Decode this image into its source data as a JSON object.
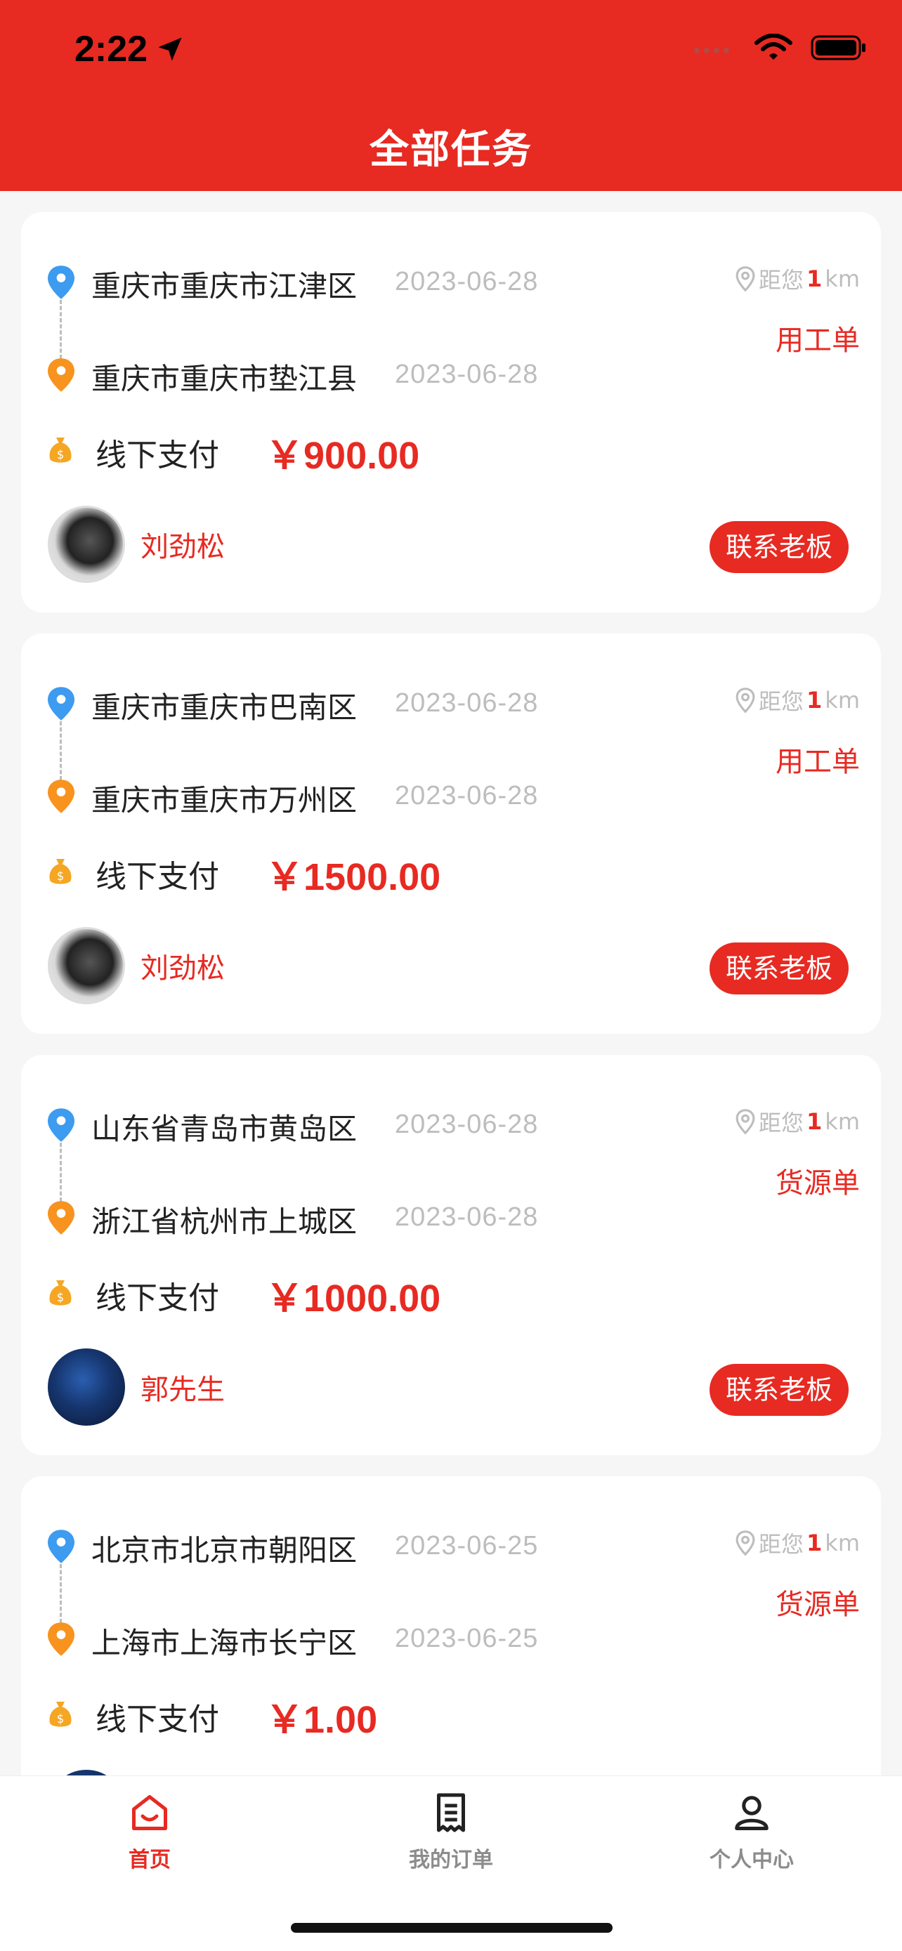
{
  "status_bar": {
    "time": "2:22"
  },
  "header": {
    "title": "全部任务"
  },
  "labels": {
    "distance_prefix": "距您",
    "distance_unit": "km",
    "contact": "联系老板",
    "currency": "￥"
  },
  "tasks": [
    {
      "from": "重庆市重庆市江津区",
      "from_date": "2023-06-28",
      "to": "重庆市重庆市垫江县",
      "to_date": "2023-06-28",
      "distance": "1",
      "type": "用工单",
      "payment": "线下支付",
      "price": "￥900.00",
      "user": "刘劲松"
    },
    {
      "from": "重庆市重庆市巴南区",
      "from_date": "2023-06-28",
      "to": "重庆市重庆市万州区",
      "to_date": "2023-06-28",
      "distance": "1",
      "type": "用工单",
      "payment": "线下支付",
      "price": "￥1500.00",
      "user": "刘劲松"
    },
    {
      "from": "山东省青岛市黄岛区",
      "from_date": "2023-06-28",
      "to": "浙江省杭州市上城区",
      "to_date": "2023-06-28",
      "distance": "1",
      "type": "货源单",
      "payment": "线下支付",
      "price": "￥1000.00",
      "user": "郭先生"
    },
    {
      "from": "北京市北京市朝阳区",
      "from_date": "2023-06-25",
      "to": "上海市上海市长宁区",
      "to_date": "2023-06-25",
      "distance": "1",
      "type": "货源单",
      "payment": "线下支付",
      "price": "￥1.00",
      "user": ""
    }
  ],
  "tabbar": [
    {
      "label": "首页",
      "icon": "home-icon",
      "active": true
    },
    {
      "label": "我的订单",
      "icon": "receipt-icon",
      "active": false
    },
    {
      "label": "个人中心",
      "icon": "person-icon",
      "active": false
    }
  ],
  "colors": {
    "brand": "#e72a22",
    "origin_pin": "#3d9bf0",
    "dest_pin": "#f7931e",
    "bag": "#f5a623"
  }
}
